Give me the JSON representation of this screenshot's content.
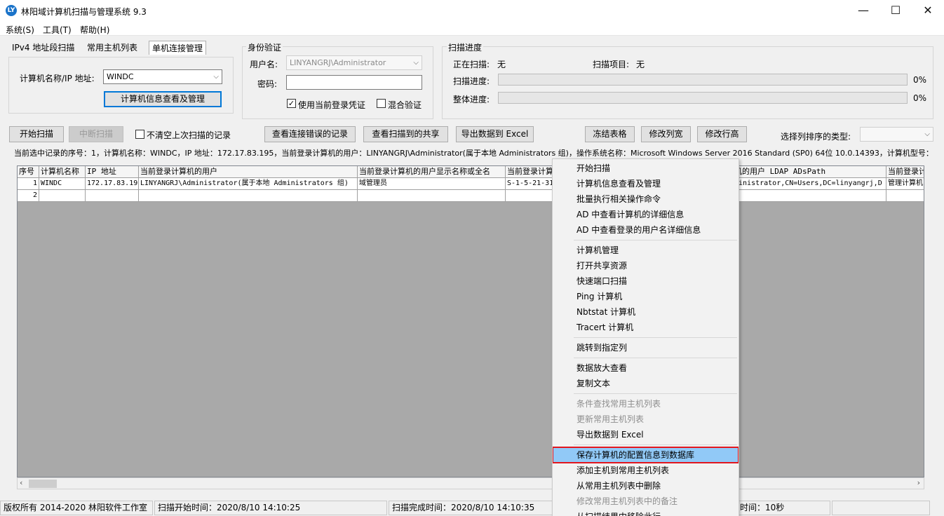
{
  "window": {
    "title": "林阳域计算机扫描与管理系统 9.3",
    "icon_text": "LY",
    "min_glyph": "—",
    "max_glyph": "☐",
    "close_glyph": "✕"
  },
  "menu": [
    "系统(S)",
    "工具(T)",
    "帮助(H)"
  ],
  "tabs": [
    "IPv4 地址段扫描",
    "常用主机列表",
    "单机连接管理"
  ],
  "single_conn": {
    "host_label": "计算机名称/IP 地址:",
    "host_value": "WINDC",
    "view_button": "计算机信息查看及管理"
  },
  "auth": {
    "group_label": "身份验证",
    "user_label": "用户名:",
    "user_value": "LINYANGRJ\\Administrator",
    "password_label": "密码:",
    "password_value": "",
    "use_current_label": "使用当前登录凭证",
    "use_current_checked": "✓",
    "mixed_label": "混合验证"
  },
  "progress": {
    "group_label": "扫描进度",
    "scanning_label": "正在扫描:",
    "scanning_value": "无",
    "item_label": "扫描项目:",
    "item_value": "无",
    "scan_progress_label": "扫描进度:",
    "scan_progress_pct": "0%",
    "scan_progress_value": 0,
    "total_progress_label": "整体进度:",
    "total_progress_pct": "0%",
    "total_progress_value": 0
  },
  "toolbar": {
    "start_scan": "开始扫描",
    "stop_scan": "中断扫描",
    "keep_records_label": "不清空上次扫描的记录",
    "view_errors": "查看连接错误的记录",
    "view_shares": "查看扫描到的共享",
    "export_excel": "导出数据到 Excel",
    "freeze": "冻结表格",
    "col_width": "修改列宽",
    "row_height": "修改行高",
    "sort_type_label": "选择列排序的类型:",
    "sort_type_value": ""
  },
  "info_line": "当前选中记录的序号：1，计算机名称：WINDC，IP 地址：172.17.83.195，当前登录计算机的用户：LINYANGRJ\\Administrator(属于本地 Administrators 组)，操作系统名称：Microsoft Windows Server 2016 Standard (SP0) 64位 10.0.14393，计算机型号：Virtual M",
  "grid": {
    "headers": [
      "序号",
      "计算机名称",
      "IP 地址",
      "当前登录计算机的用户",
      "当前登录计算机的用户显示名称或全名",
      "当前登录计算",
      "",
      "",
      "机的用户 LDAP ADsPath",
      "当前登录计"
    ],
    "rows": [
      [
        "1",
        "WINDC",
        "172.17.83.195",
        "LINYANGRJ\\Administrator(属于本地 Administrators 组)",
        "域管理员",
        "S-1-5-21-31",
        "",
        "",
        "ministrator,CN=Users,DC=linyangrj,D",
        "管理计算机"
      ],
      [
        "2",
        "",
        "",
        "",
        "",
        "",
        "",
        "",
        "",
        ""
      ]
    ]
  },
  "hscroll": {
    "left": "‹",
    "right": "›"
  },
  "context_menu": {
    "groups": [
      [
        {
          "label": "开始扫描",
          "disabled": false
        },
        {
          "label": "计算机信息查看及管理",
          "disabled": false
        },
        {
          "label": "批量执行相关操作命令",
          "disabled": false
        },
        {
          "label": "AD 中查看计算机的详细信息",
          "disabled": false
        },
        {
          "label": "AD 中查看登录的用户名详细信息",
          "disabled": false
        }
      ],
      [
        {
          "label": "计算机管理",
          "disabled": false
        },
        {
          "label": "打开共享资源",
          "disabled": false
        },
        {
          "label": "快速端口扫描",
          "disabled": false
        },
        {
          "label": "Ping 计算机",
          "disabled": false
        },
        {
          "label": "Nbtstat 计算机",
          "disabled": false
        },
        {
          "label": "Tracert 计算机",
          "disabled": false
        }
      ],
      [
        {
          "label": "跳转到指定列",
          "disabled": false
        }
      ],
      [
        {
          "label": "数据放大查看",
          "disabled": false
        },
        {
          "label": "复制文本",
          "disabled": false
        }
      ],
      [
        {
          "label": "条件查找常用主机列表",
          "disabled": true
        },
        {
          "label": "更新常用主机列表",
          "disabled": true
        },
        {
          "label": "导出数据到 Excel",
          "disabled": false
        }
      ],
      [
        {
          "label": "保存计算机的配置信息到数据库",
          "disabled": false,
          "highlighted": true
        },
        {
          "label": "添加主机到常用主机列表",
          "disabled": false
        },
        {
          "label": "从常用主机列表中删除",
          "disabled": false
        },
        {
          "label": "修改常用主机列表中的备注",
          "disabled": true
        },
        {
          "label": "从扫描结果中移除此行",
          "disabled": false
        }
      ]
    ]
  },
  "statusbar": {
    "copyright": "版权所有 2014-2020 林阳软件工作室",
    "scan_start": "扫描开始时间：2020/8/10 14:10:25",
    "scan_end": "扫描完成时间：2020/8/10 14:10:35",
    "elapsed": "时间：10秒",
    "extra": ""
  },
  "colors": {
    "highlight_bg": "#91c9f7",
    "highlight_border": "#e2161e",
    "primary_border": "#0078d7"
  }
}
